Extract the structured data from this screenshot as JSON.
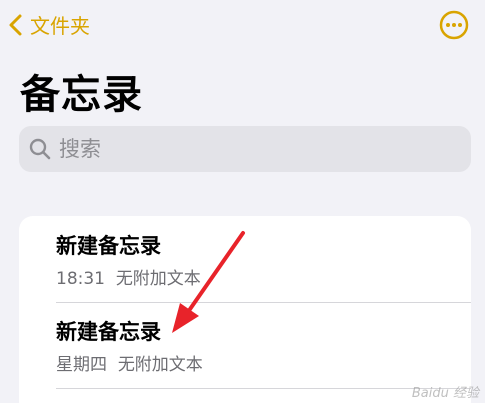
{
  "nav": {
    "back_label": "文件夹",
    "accent_color": "#d9a400",
    "back_icon": "chevron-left-icon",
    "more_icon": "ellipsis-circle-icon"
  },
  "page_title": "备忘录",
  "search": {
    "placeholder": "搜索",
    "value": "",
    "icon": "search-icon"
  },
  "notes": [
    {
      "title": "新建备忘录",
      "time": "18:31",
      "preview": "无附加文本"
    },
    {
      "title": "新建备忘录",
      "time": "星期四",
      "preview": "无附加文本"
    }
  ],
  "annotation": {
    "color": "#e8232a"
  },
  "watermark": "Baidu 经验"
}
